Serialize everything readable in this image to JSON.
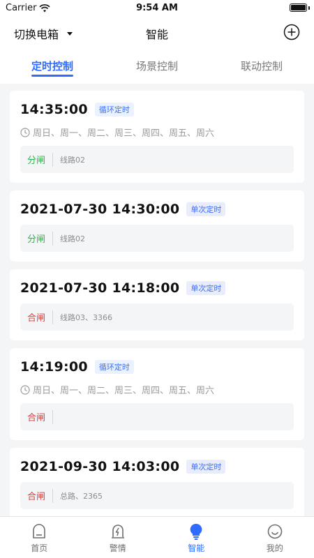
{
  "status": {
    "carrier": "Carrier",
    "time": "9:54 AM"
  },
  "nav": {
    "switch_label": "切换电箱",
    "title": "智能"
  },
  "tabs": [
    "定时控制",
    "场景控制",
    "联动控制"
  ],
  "cards": [
    {
      "time": "14:35:00",
      "badge": "循环定时",
      "days": "周日、周一、周二、周三、周四、周五、周六",
      "action": "分闸",
      "circuit": "线路02"
    },
    {
      "time": "2021-07-30 14:30:00",
      "badge": "单次定时",
      "action": "分闸",
      "circuit": "线路02"
    },
    {
      "time": "2021-07-30 14:18:00",
      "badge": "单次定时",
      "action": "合闸",
      "circuit": "线路03、3366"
    },
    {
      "time": "14:19:00",
      "badge": "循环定时",
      "days": "周日、周一、周二、周三、周四、周五、周六",
      "action": "合闸",
      "circuit": ""
    },
    {
      "time": "2021-09-30 14:03:00",
      "badge": "单次定时",
      "action": "合闸",
      "circuit": "总路、2365"
    }
  ],
  "bottom_nav": [
    "首页",
    "警情",
    "智能",
    "我的"
  ],
  "colors": {
    "accent": "#2f6bff",
    "open": "#2fb24a",
    "close": "#d8413c"
  }
}
